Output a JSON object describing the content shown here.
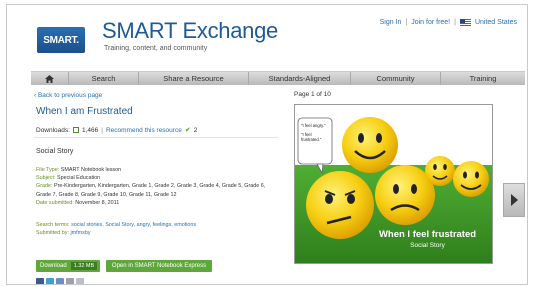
{
  "header": {
    "logo": "SMART.",
    "title": "SMART Exchange",
    "tagline": "Training, content, and community",
    "sign_in": "Sign In",
    "join": "Join for free!",
    "separator": "|",
    "region": "United States"
  },
  "nav": {
    "items": [
      "Search",
      "Share a Resource",
      "Standards-Aligned",
      "Community",
      "Training"
    ]
  },
  "resource": {
    "back_link": "‹ Back to previous page",
    "title": "When I am Frustrated",
    "downloads_label": "Downloads:",
    "downloads_count": "1,466",
    "recommend": "Recommend this resource",
    "recommend_count": "2",
    "description": "Social Story",
    "meta": [
      {
        "key": "File Type:",
        "value": "SMART Notebook lesson"
      },
      {
        "key": "Subject:",
        "value": "Special Education"
      },
      {
        "key": "Grade:",
        "value": "Pre-Kindergarten, Kindergarten, Grade 1, Grade 2, Grade 3, Grade 4, Grade 5, Grade 6, Grade 7, Grade 8, Grade 9, Grade 10, Grade 11, Grade 12"
      },
      {
        "key": "Date submitted:",
        "value": "November 8, 2011"
      }
    ],
    "search_terms_label": "Search terms:",
    "search_terms": "social stories, Social Story, angry, feelings, emotions",
    "submitted_by_label": "Submitted by:",
    "submitted_by": "jmfmsby",
    "download_label": "Download",
    "download_size": "1.32 MB",
    "open_label": "Open in SMART Notebook Express"
  },
  "preview": {
    "page_label": "Page 1 of 10",
    "bubble_line1": "\"I feel angry.\"",
    "bubble_line2": "\"I feel frustrated.\"",
    "caption_title": "When I feel frustrated",
    "caption_sub": "Social Story"
  },
  "colors": {
    "brand_blue": "#1f5a96",
    "link_blue": "#2a6fb3",
    "green_button": "#5ea83a",
    "preview_green": "#3e9a2a"
  }
}
